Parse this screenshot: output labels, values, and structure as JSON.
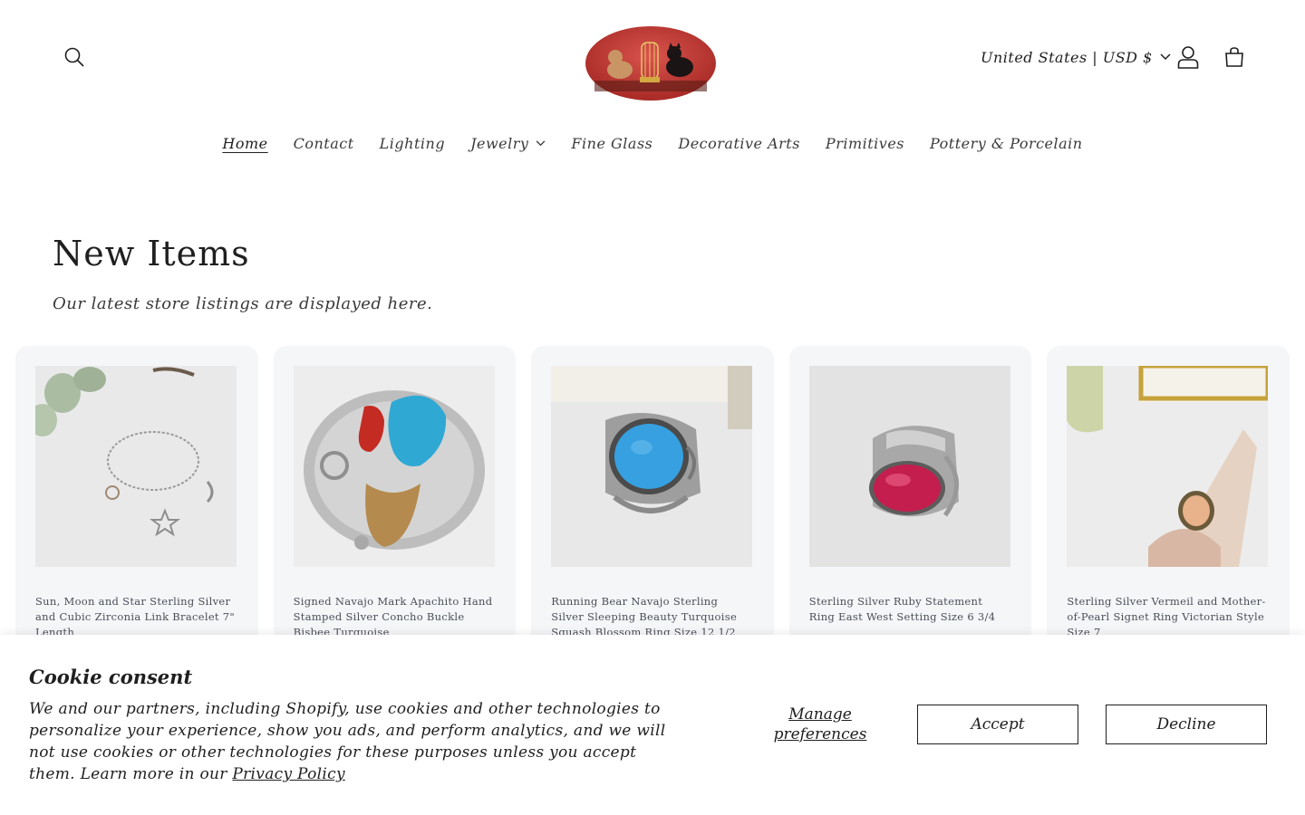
{
  "header": {
    "country_selector": "United States | USD $",
    "icons": {
      "search": "search-icon",
      "account": "account-icon",
      "cart": "cart-icon",
      "chevron": "chevron-down-icon"
    }
  },
  "nav": {
    "items": [
      {
        "label": "Home",
        "active": true
      },
      {
        "label": "Contact"
      },
      {
        "label": "Lighting"
      },
      {
        "label": "Jewelry",
        "has_dropdown": true
      },
      {
        "label": "Fine Glass"
      },
      {
        "label": "Decorative Arts"
      },
      {
        "label": "Primitives"
      },
      {
        "label": "Pottery & Porcelain"
      }
    ]
  },
  "section": {
    "title": "New Items",
    "subtitle": "Our latest store listings are displayed here."
  },
  "products": [
    {
      "title": "Sun, Moon and Star Sterling Silver and Cubic Zirconia Link Bracelet 7\" Length"
    },
    {
      "title": "Signed Navajo Mark Apachito Hand Stamped Silver Concho Buckle Bisbee Turquoise"
    },
    {
      "title": "Running Bear Navajo Sterling Silver Sleeping Beauty Turquoise Squash Blossom Ring Size 12 1/2"
    },
    {
      "title": "Sterling Silver Ruby Statement Ring East West Setting Size 6 3/4"
    },
    {
      "title": "Sterling Silver Vermeil and Mother-of-Pearl Signet Ring Victorian Style Size 7"
    }
  ],
  "cookie": {
    "title": "Cookie consent",
    "text": "We and our partners, including Shopify, use cookies and other technologies to personalize your experience, show you ads, and perform analytics, and we will not use cookies or other technologies for these purposes unless you accept them. Learn more in our ",
    "link": "Privacy Policy",
    "manage": "Manage preferences",
    "accept": "Accept",
    "decline": "Decline"
  },
  "colors": {
    "card_bg": "#f4f6f8",
    "text": "#1f1f1f"
  }
}
